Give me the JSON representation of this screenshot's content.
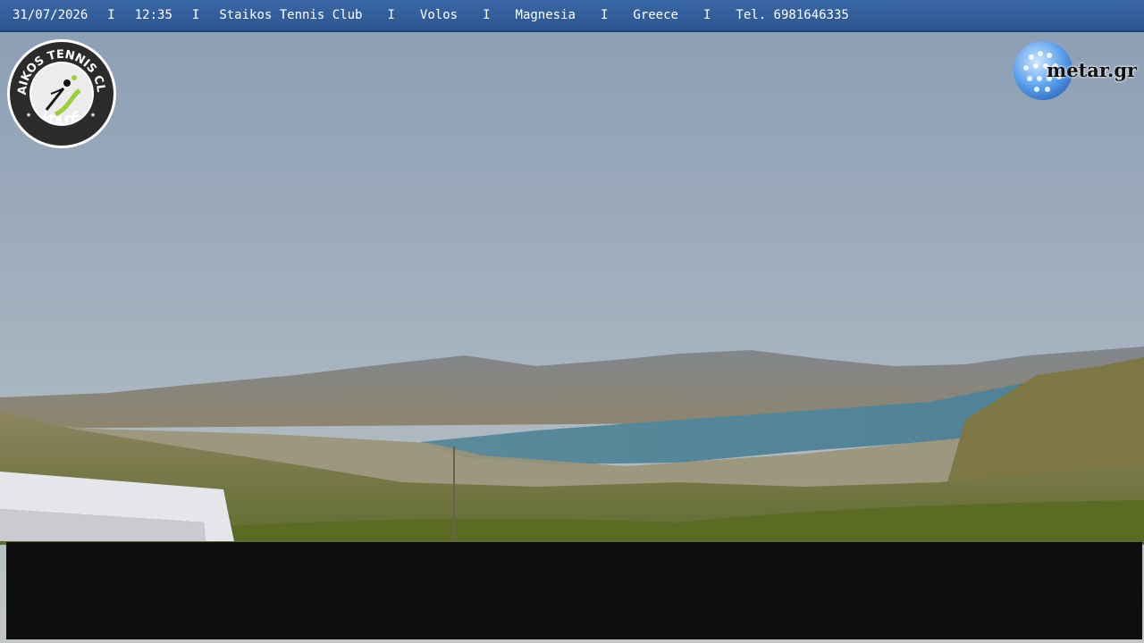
{
  "overlay": {
    "date": "31/07/2026",
    "time": "12:35",
    "club": "Staikos Tennis Club",
    "city": "Volos",
    "region": "Magnesia",
    "country": "Greece",
    "phone": "Tel. 6981646335",
    "separator": "I"
  },
  "logo_left": {
    "text_top": "STAIKOS TENNIS CLUB",
    "text_bottom": "VOLOS"
  },
  "logo_right": {
    "text": "metar.gr"
  },
  "colors": {
    "bar": "#2f5b99",
    "sky_top": "#8fa3b8",
    "sea": "#4d7d8f",
    "hills": "#6e6a52"
  }
}
